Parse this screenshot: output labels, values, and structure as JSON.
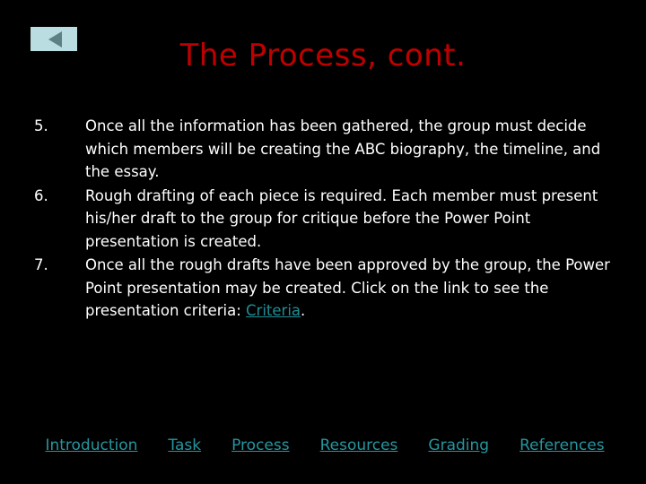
{
  "slide": {
    "background_color": "#000000",
    "title": "The Process, cont.",
    "title_color": "#c00000"
  },
  "back_button": {
    "label": "Back",
    "icon": "triangle-left-icon",
    "fill_color": "#b9dde1",
    "arrow_color": "#5d7f85"
  },
  "body": {
    "text_color": "#ffffff",
    "items": [
      {
        "number": "5.",
        "text": "Once all the information has been gathered, the group must decide which members will be creating the ABC biography, the timeline, and the essay."
      },
      {
        "number": "6.",
        "text": "Rough drafting of each piece is required. Each member must present his/her draft to the group for critique before the Power Point presentation is created."
      },
      {
        "number": "7.",
        "text_before_link": "Once all the rough drafts have been approved by the group, the Power Point presentation may be created. Click on the link to see the presentation criteria: ",
        "link_label": "Criteria",
        "link_color": "#1f8f96",
        "text_after_link": "."
      }
    ]
  },
  "bottom_nav": {
    "link_color": "#2596a0",
    "links": [
      {
        "label": "Introduction"
      },
      {
        "label": "Task "
      },
      {
        "label": "Process"
      },
      {
        "label": "Resources"
      },
      {
        "label": "Grading"
      },
      {
        "label": "References"
      }
    ]
  }
}
